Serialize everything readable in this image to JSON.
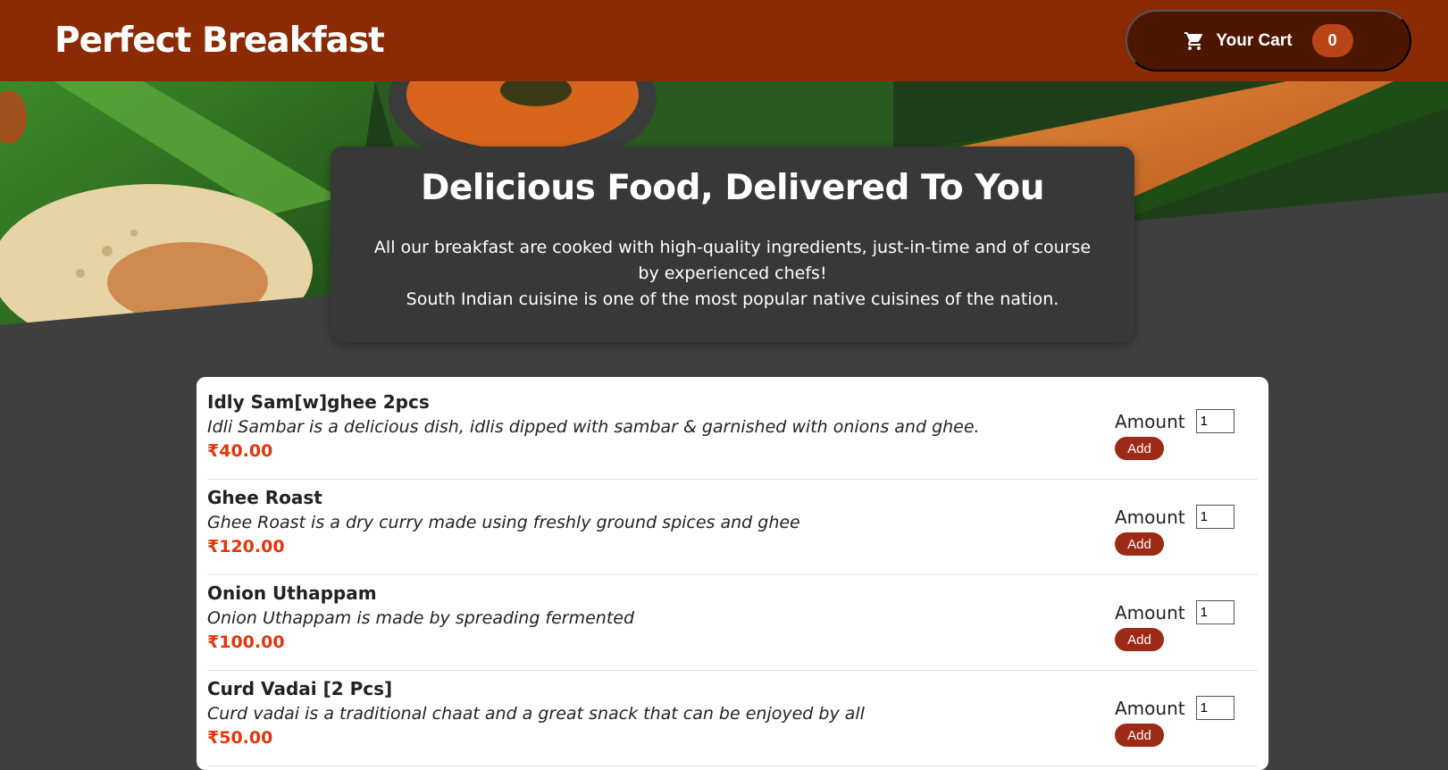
{
  "header": {
    "brand": "Perfect Breakfast",
    "cart_label": "Your Cart",
    "cart_count": "0"
  },
  "summary": {
    "title": "Delicious Food, Delivered To You",
    "text_1": "All our breakfast are cooked with high-quality ingredients, just-in-time and of course by experienced chefs!",
    "text_2": "South Indian cuisine is one of the most popular native cuisines of the nation."
  },
  "meals": [
    {
      "name": "Idly Sam[w]ghee 2pcs",
      "description": "Idli Sambar is a delicious dish, idlis dipped with sambar & garnished with onions and ghee.",
      "price": "₹40.00",
      "amount": "1"
    },
    {
      "name": "Ghee Roast",
      "description": "Ghee Roast is a dry curry made using freshly ground spices and ghee",
      "price": "₹120.00",
      "amount": "1"
    },
    {
      "name": "Onion Uthappam",
      "description": "Onion Uthappam is made by spreading fermented",
      "price": "₹100.00",
      "amount": "1"
    },
    {
      "name": "Curd Vadai [2 Pcs]",
      "description": "Curd vadai is a traditional chaat and a great snack that can be enjoyed by all",
      "price": "₹50.00",
      "amount": "1"
    }
  ],
  "form": {
    "amount_label": "Amount",
    "add_label": "Add"
  },
  "colors": {
    "header": "#8a2b06",
    "cart_button": "#4d1601",
    "badge": "#b94517",
    "price": "#e0360d",
    "add_button": "#9b2a16",
    "background": "#3f3f3f"
  }
}
